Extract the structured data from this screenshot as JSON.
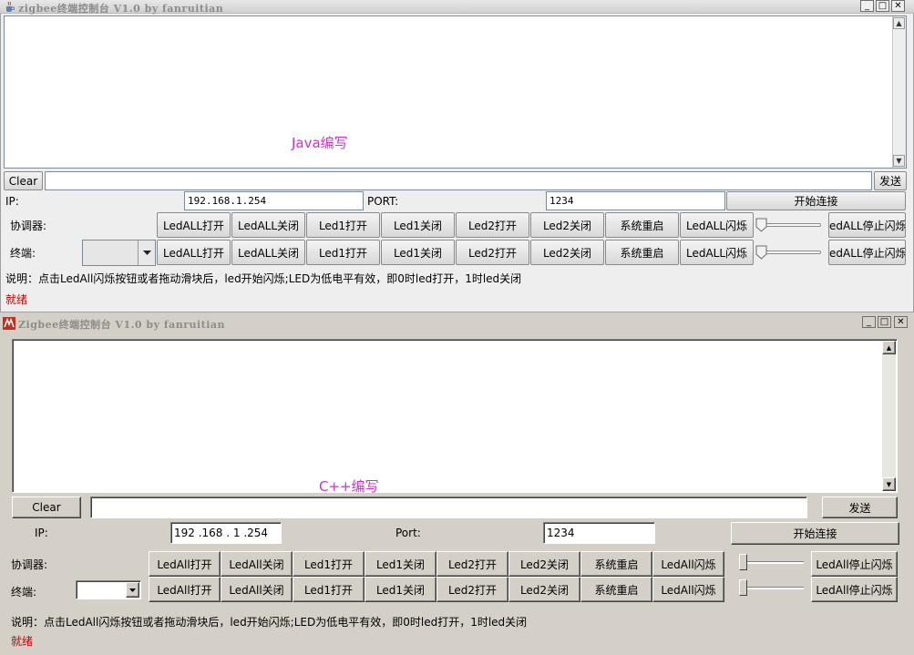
{
  "java": {
    "title": "zigbee终端控制台 V1.0 by fanruitian",
    "window_controls": {
      "minimize": "_",
      "maximize": "□",
      "close": "✕"
    },
    "watermark": "Java编写",
    "clear_label": "Clear",
    "send_label": "发送",
    "message_value": "",
    "ip_label": "IP:",
    "ip_value": "192.168.1.254",
    "port_label": "PORT:",
    "port_value": "1234",
    "connect_label": "开始连接",
    "coordinator_label": "协调器:",
    "terminal_label": "终端:",
    "terminal_selected": "",
    "buttons": [
      "LedALL打开",
      "LedALL关闭",
      "Led1打开",
      "Led1关闭",
      "Led2打开",
      "Led2关闭",
      "系统重启",
      "LedALL闪烁"
    ],
    "stop_flash_label": "LedALL停止闪烁",
    "stop_flash_visible": "edALL停止闪烁",
    "note": "说明：点击LedAll闪烁按钮或者拖动滑块后，led开始闪烁;LED为低电平有效，即0时led打开，1时led关闭",
    "status": "就绪"
  },
  "cpp": {
    "title": "Zigbee终端控制台 V1.0 by fanruitian",
    "window_controls": {
      "minimize": "_",
      "maximize": "□",
      "close": "✕"
    },
    "watermark": "C++编写",
    "clear_label": "Clear",
    "send_label": "发送",
    "message_value": "",
    "ip_label": "IP:",
    "ip_value": "192 .168 . 1  .254",
    "port_label": "Port:",
    "port_value": "1234",
    "connect_label": "开始连接",
    "coordinator_label": "协调器:",
    "terminal_label": "终端:",
    "terminal_selected": "",
    "buttons": [
      "LedAll打开",
      "LedAll关闭",
      "Led1打开",
      "Led1关闭",
      "Led2打开",
      "Led2关闭",
      "系统重启",
      "LedAll闪烁"
    ],
    "stop_flash_label": "LedAll停止闪烁",
    "note": "说明：点击LedAll闪烁按钮或者拖动滑块后，led开始闪烁;LED为低电平有效，即0时led打开，1时led关闭",
    "status": "就绪"
  },
  "colors": {
    "watermark": "#cc33cc",
    "status": "#cc0000",
    "app_bg": "#d4d0c8"
  },
  "icons": {
    "java_app_icon": "java-cup-icon",
    "cpp_app_icon": "mfc-app-icon"
  }
}
